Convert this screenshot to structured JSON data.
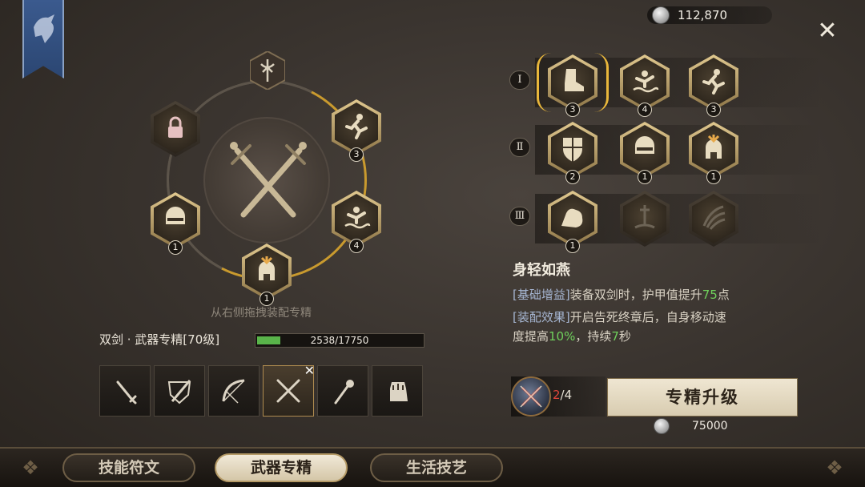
{
  "header": {
    "currency_amount": "112,870",
    "close_label": "✕"
  },
  "wheel": {
    "lock_slot": "lock",
    "slots": [
      {
        "name": "sprinter",
        "level": "3"
      },
      {
        "name": "swimmer",
        "level": "4"
      },
      {
        "name": "spartan-helmet",
        "level": "1"
      },
      {
        "name": "visor-helmet",
        "level": "1"
      }
    ],
    "drag_hint": "从右侧拖拽装配专精"
  },
  "weapon": {
    "title": "双剑 · 武器专精[70级]",
    "xp_text": "2538/17750",
    "xp_fraction": 0.143,
    "types": [
      "dagger",
      "shield-sword",
      "bow",
      "dual-swords",
      "staff",
      "gauntlet"
    ],
    "selected_index": 3,
    "selected_mark": "✕"
  },
  "tiers": [
    {
      "label": "Ⅰ",
      "talents": [
        {
          "icon": "boot",
          "level": "3",
          "state": "selected"
        },
        {
          "icon": "swimmer",
          "level": "4",
          "state": "owned"
        },
        {
          "icon": "sprinter",
          "level": "3",
          "state": "owned"
        }
      ]
    },
    {
      "label": "Ⅱ",
      "talents": [
        {
          "icon": "shield",
          "level": "2",
          "state": "owned"
        },
        {
          "icon": "visor-helmet",
          "level": "1",
          "state": "owned"
        },
        {
          "icon": "spartan-helmet",
          "level": "1",
          "state": "owned"
        }
      ]
    },
    {
      "label": "Ⅲ",
      "talents": [
        {
          "icon": "muscle-arm",
          "level": "1",
          "state": "owned"
        },
        {
          "icon": "sword-ground",
          "level": "",
          "state": "locked"
        },
        {
          "icon": "claw",
          "level": "",
          "state": "locked"
        }
      ]
    }
  ],
  "skill": {
    "name": "身轻如燕",
    "line1_tag": "[基础增益]",
    "line1_text": "装备双剑时，护甲值提升",
    "line1_num": "75",
    "line1_tail": "点",
    "line2_tag": "[装配效果]",
    "line2_text": "开启告死终章后，自身移动速",
    "line3_text": "度提高",
    "line3_num1": "10%",
    "line3_mid": "，持续",
    "line3_num2": "7",
    "line3_tail": "秒"
  },
  "upgrade": {
    "material_have": "2",
    "material_need": "/4",
    "button_label": "专精升级",
    "cost": "75000"
  },
  "nav": {
    "tabs": [
      "技能符文",
      "武器专精",
      "生活技艺"
    ],
    "active_index": 1
  },
  "colors": {
    "accent_gold": "#c99a2e",
    "xp_green": "#59b44a",
    "highlight_green": "#6fd05c",
    "insufficient_red": "#e0453a"
  }
}
